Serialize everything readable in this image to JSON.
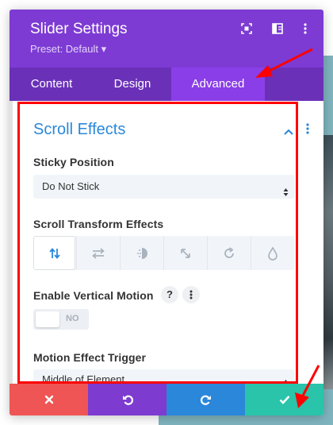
{
  "modal": {
    "title": "Slider Settings",
    "preset": "Preset: Default ▾"
  },
  "header_icons": {
    "focus": "focus-mode-icon",
    "sidebar": "sidebar-toggle-icon",
    "more": "more-vertical-icon"
  },
  "tabs": [
    {
      "label": "Content"
    },
    {
      "label": "Design"
    },
    {
      "label": "Advanced",
      "active": true
    }
  ],
  "section": {
    "title": "Scroll Effects",
    "expanded": true
  },
  "fields": {
    "sticky_position": {
      "label": "Sticky Position",
      "value": "Do Not Stick"
    },
    "scroll_transform": {
      "label": "Scroll Transform Effects",
      "icons": [
        "vertical-motion-icon",
        "horizontal-motion-icon",
        "fading-icon",
        "scaling-icon",
        "rotating-icon",
        "blur-icon"
      ],
      "active_index": 0
    },
    "vertical_motion": {
      "label": "Enable Vertical Motion",
      "help": "?",
      "toggle_text": "NO",
      "enabled": false
    },
    "motion_trigger": {
      "label": "Motion Effect Trigger",
      "value": "Middle of Element"
    }
  },
  "footer": {
    "buttons": [
      "discard-icon",
      "undo-icon",
      "redo-icon",
      "save-check-icon"
    ]
  },
  "colors": {
    "header": "#7d3bd3",
    "tabs": "#6a31b8",
    "active_tab": "#8a3ee8",
    "accent_blue": "#2b87da",
    "discard": "#ef5555",
    "undo": "#7e3bd0",
    "redo": "#2b87da",
    "save": "#29c4a9",
    "annotation": "#ff0000"
  }
}
